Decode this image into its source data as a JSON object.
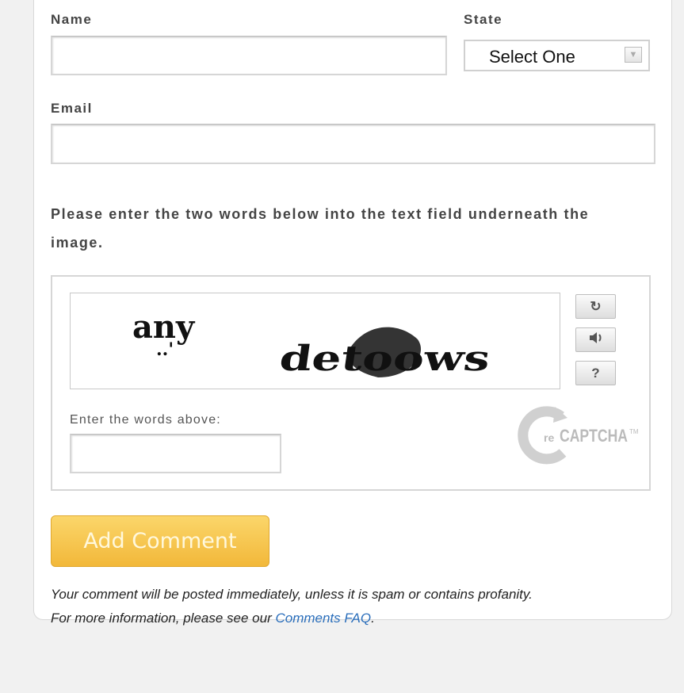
{
  "form": {
    "name_label": "Name",
    "state_label": "State",
    "state_value": "Select One",
    "email_label": "Email",
    "name_value": "",
    "email_value": ""
  },
  "captcha": {
    "instructions": "Please enter the two words below into the text field underneath the image.",
    "word1": "any",
    "word2": "detoows",
    "input_label": "Enter the words above:",
    "input_value": "",
    "help_label": "?",
    "brand": "reCAPTCHA",
    "brand_prefix": "re",
    "brand_main": "CAPTCHA",
    "brand_tm": "TM",
    "icons": [
      "refresh-icon",
      "audio-icon",
      "help-icon"
    ]
  },
  "submit": {
    "label": "Add Comment"
  },
  "note": {
    "line1": "Your comment will be posted immediately, unless it is spam or contains profanity.",
    "line2_prefix": "For more information, please see our ",
    "link": "Comments FAQ",
    "line2_suffix": "."
  },
  "colors": {
    "button": "#f2b83a",
    "link": "#2a6ebb"
  }
}
